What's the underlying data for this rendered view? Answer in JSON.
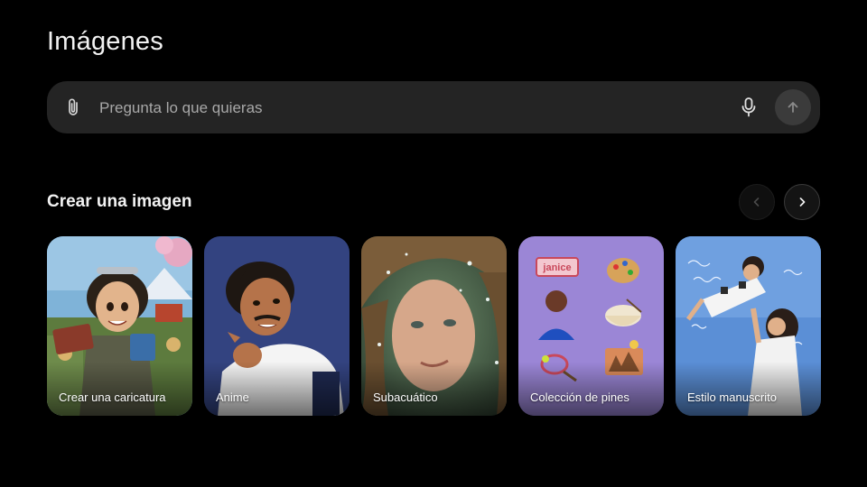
{
  "page": {
    "title": "Imágenes"
  },
  "search": {
    "placeholder": "Pregunta lo que quieras",
    "attach_icon": "paperclip-icon",
    "mic_icon": "microphone-icon",
    "send_icon": "arrow-up-icon"
  },
  "section": {
    "title": "Crear una imagen",
    "prev_icon": "chevron-left-icon",
    "next_icon": "chevron-right-icon"
  },
  "cards": [
    {
      "label": "Crear una caricatura"
    },
    {
      "label": "Anime"
    },
    {
      "label": "Subacuático"
    },
    {
      "label": "Colección de pines",
      "pin_name": "janice"
    },
    {
      "label": "Estilo manuscrito"
    }
  ]
}
